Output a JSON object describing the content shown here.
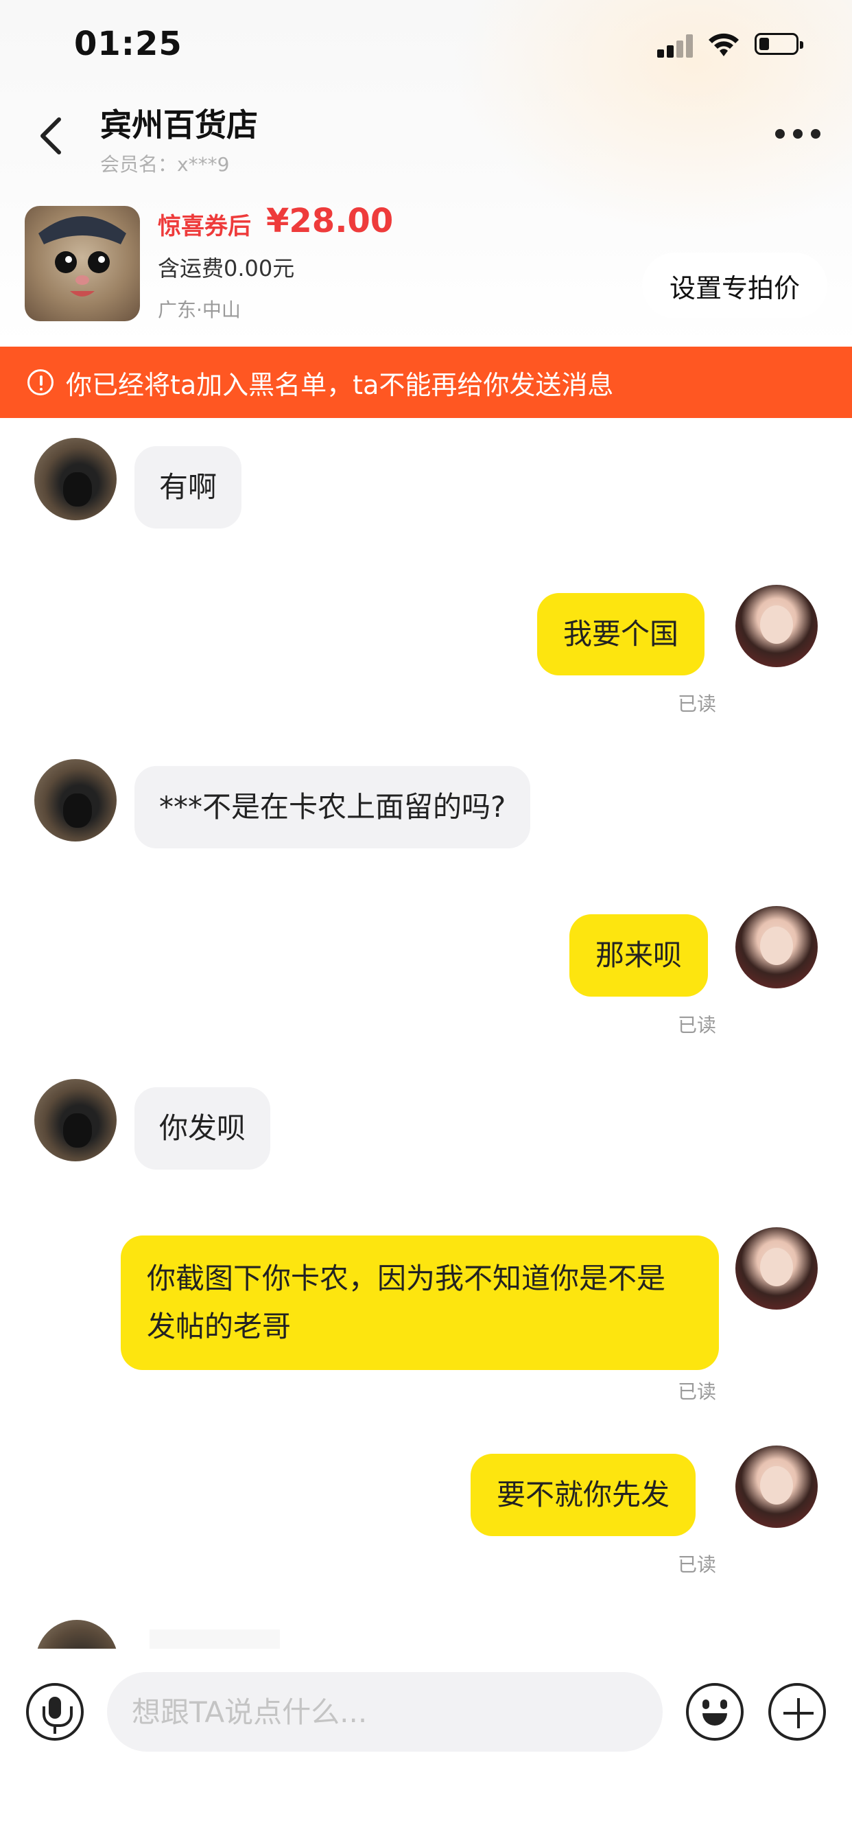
{
  "status_bar": {
    "time": "01:25"
  },
  "header": {
    "shop_name": "宾州百货店",
    "member_label": "会员名：x***9"
  },
  "product": {
    "coupon_label": "惊喜券后",
    "price": "¥28.00",
    "shipping": "含运费0.00元",
    "location": "广东·中山",
    "special_price_button": "设置专拍价"
  },
  "banner": {
    "text": "你已经将ta加入黑名单，ta不能再给你发送消息",
    "color": "#ff5722"
  },
  "messages": [
    {
      "side": "left",
      "text": "有啊"
    },
    {
      "side": "right",
      "text": "我要个国",
      "status": "已读"
    },
    {
      "side": "left",
      "text": "***不是在卡农上面留的吗?"
    },
    {
      "side": "right",
      "text": "那来呗",
      "status": "已读"
    },
    {
      "side": "left",
      "text": "你发呗"
    },
    {
      "side": "right",
      "text": "你截图下你卡农，因为我不知道你是不是发帖的老哥",
      "status": "已读"
    },
    {
      "side": "right",
      "text": "要不就你先发",
      "status": "已读"
    }
  ],
  "input_bar": {
    "placeholder": "想跟TA说点什么..."
  },
  "icons": [
    "back-arrow-icon",
    "more-icon",
    "warning-icon",
    "mic-icon",
    "emoji-icon",
    "plus-icon"
  ],
  "colors": {
    "my_bubble": "#fde50f",
    "their_bubble": "#f2f2f4",
    "price_red": "#ee3b3b"
  }
}
